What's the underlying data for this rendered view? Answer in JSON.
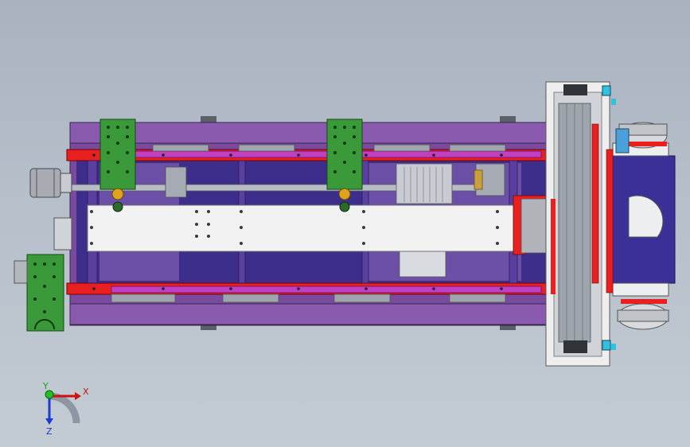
{
  "scene": {
    "background_top": "#a9b3c0",
    "background_bottom": "#c3cbd3",
    "colors": {
      "purple": "#7a4a9e",
      "purple_dark": "#4e2d74",
      "magenta": "#c040c0",
      "red": "#e82020",
      "green": "#3a9a3a",
      "white": "#f4f4f4",
      "gray": "#9aa0a8",
      "navy": "#2a2a8e",
      "cyan": "#30c0e0"
    }
  },
  "triad": {
    "x_label": "X",
    "y_label": "Y",
    "z_label": "Z"
  }
}
